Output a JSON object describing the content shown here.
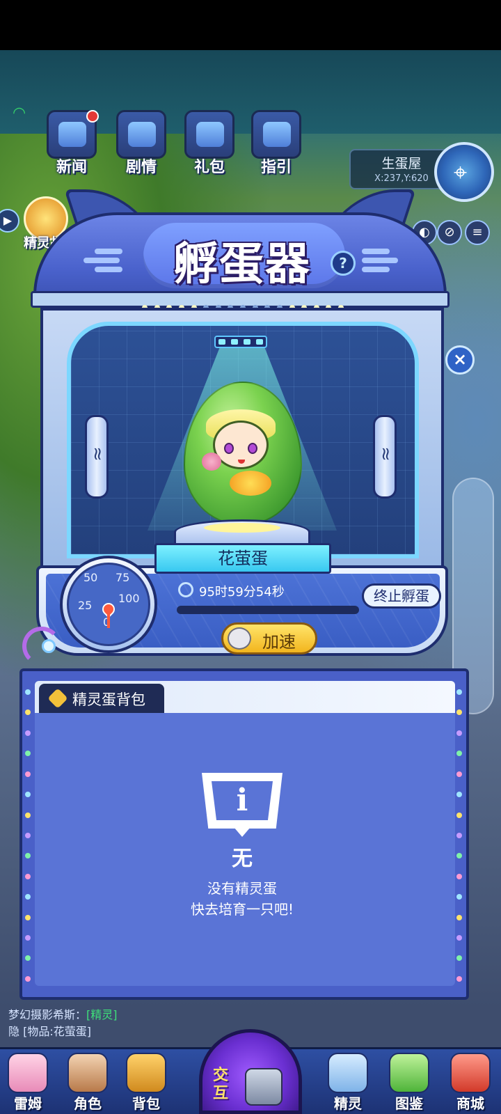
{
  "top_nav": [
    {
      "label": "新闻",
      "icon": "newspaper-icon",
      "badge": true
    },
    {
      "label": "剧情",
      "icon": "story-chest-icon",
      "badge": false
    },
    {
      "label": "礼包",
      "icon": "gift-chest-icon",
      "badge": false
    },
    {
      "label": "指引",
      "icon": "guide-chest-icon",
      "badge": false
    }
  ],
  "location": {
    "name": "生蛋屋",
    "coords": "X:237,Y:620"
  },
  "left_event": {
    "label": "精灵战令"
  },
  "incubator": {
    "title": "孵蛋器",
    "help": "?",
    "egg_name": "花萤蛋",
    "timer": "95时59分54秒",
    "progress": 0.0,
    "stop_label": "终止孵蛋",
    "speed_label": "加速",
    "gauge_ticks": [
      "0",
      "25",
      "50",
      "75",
      "100"
    ]
  },
  "backpack": {
    "tab_label": "精灵蛋背包",
    "empty_title": "无",
    "empty_line1": "没有精灵蛋",
    "empty_line2": "快去培育一只吧!"
  },
  "chat": {
    "line1_prefix": "梦幻摄影希斯：",
    "line1_tag": "[精灵]",
    "line2_prefix": "隐",
    "line2_tag": "[物品:花萤蛋]"
  },
  "bottom_nav": [
    {
      "label": "雷姆",
      "icon": "leimu-avatar-icon"
    },
    {
      "label": "角色",
      "icon": "character-icon"
    },
    {
      "label": "背包",
      "icon": "backpack-icon"
    },
    {
      "label": "精灵",
      "icon": "sprite-icon"
    },
    {
      "label": "图鉴",
      "icon": "codex-icon"
    },
    {
      "label": "商城",
      "icon": "shop-icon"
    }
  ],
  "center_button": {
    "label_top": "交",
    "label_bottom": "互"
  },
  "colors": {
    "panel": "#4a60c8",
    "accent": "#79e0ff",
    "speed": "#f2b51e"
  }
}
